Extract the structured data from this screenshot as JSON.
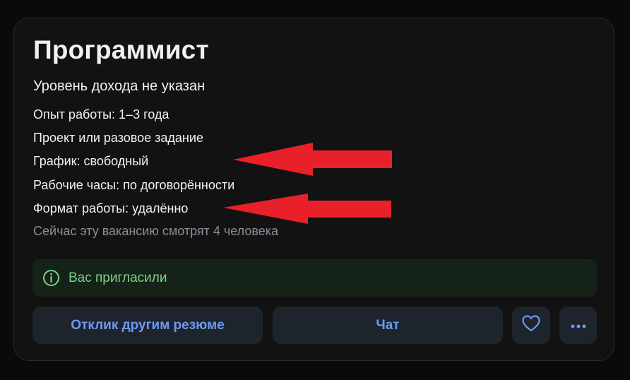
{
  "vacancy": {
    "title": "Программист",
    "salary": "Уровень дохода не указан",
    "details": [
      "Опыт работы: 1–3 года",
      "Проект или разовое задание",
      "График: свободный",
      "Рабочие часы: по договорённости",
      "Формат работы: удалённо"
    ],
    "viewers": "Сейчас эту вакансию смотрят 4 человека"
  },
  "invite": {
    "icon": "info-circle-icon",
    "text": "Вас пригласили",
    "color": "#7ed08a"
  },
  "actions": {
    "respond_label": "Отклик другим резюме",
    "chat_label": "Чат",
    "favorite_icon": "heart-icon",
    "more_icon": "more-horizontal-icon",
    "accent": "#6b9af2"
  },
  "annotations": {
    "arrow_color": "#e8202a"
  }
}
